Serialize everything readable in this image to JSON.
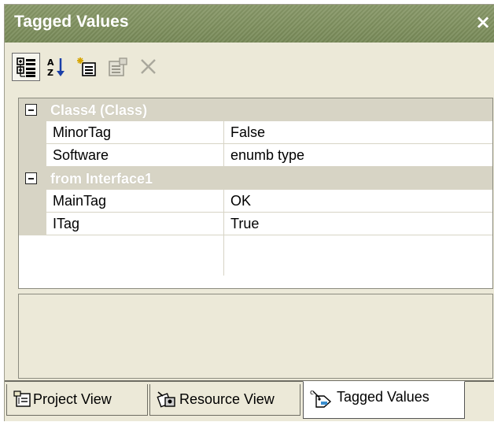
{
  "window": {
    "title": "Tagged Values",
    "close_glyph": "×"
  },
  "toolbar": {
    "buttons": [
      {
        "name": "categorized-view-icon",
        "active": true
      },
      {
        "name": "sort-alphabetical-icon",
        "active": false
      },
      {
        "name": "new-tag-icon",
        "active": false
      },
      {
        "name": "properties-icon",
        "active": false
      },
      {
        "name": "delete-icon",
        "active": false
      }
    ]
  },
  "grid": {
    "categories": [
      {
        "label": "Class4 (Class)",
        "rows": [
          {
            "name": "MinorTag",
            "value": "False"
          },
          {
            "name": "Software",
            "value": "enumb type"
          }
        ]
      },
      {
        "label": "from Interface1",
        "rows": [
          {
            "name": "MainTag",
            "value": "OK"
          },
          {
            "name": "ITag",
            "value": "True"
          }
        ]
      }
    ]
  },
  "tabs": [
    {
      "label": "Project View",
      "icon": "project-view-icon",
      "active": false
    },
    {
      "label": "Resource View",
      "icon": "resource-view-icon",
      "active": false
    },
    {
      "label": "Tagged Values",
      "icon": "tagged-values-icon",
      "active": true
    }
  ]
}
